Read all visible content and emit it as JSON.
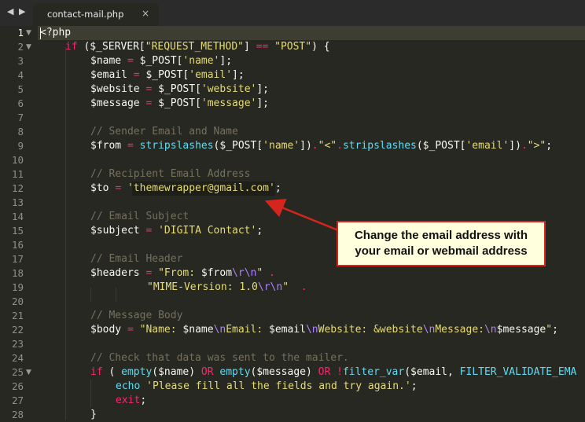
{
  "tab": {
    "label": "contact-mail.php",
    "close": "×"
  },
  "nav": {
    "back": "◀",
    "forward": "▶"
  },
  "fold_glyph": "▼",
  "gutter": [
    "1",
    "2",
    "3",
    "4",
    "5",
    "6",
    "7",
    "8",
    "9",
    "10",
    "11",
    "12",
    "13",
    "14",
    "15",
    "16",
    "17",
    "18",
    "19",
    "20",
    "21",
    "22",
    "23",
    "24",
    "25",
    "26",
    "27",
    "28"
  ],
  "code": {
    "l1": "<?php",
    "l2": {
      "kw": "if",
      "a": " ($_SERVER[",
      "s": "\"REQUEST_METHOD\"",
      "b": "] ",
      "op": "==",
      "c": " ",
      "s2": "\"POST\"",
      "d": ") {"
    },
    "l3": {
      "a": "$name ",
      "op": "=",
      "b": " $_POST[",
      "s": "'name'",
      "c": "];"
    },
    "l4": {
      "a": "$email ",
      "op": "=",
      "b": " $_POST[",
      "s": "'email'",
      "c": "];"
    },
    "l5": {
      "a": "$website ",
      "op": "=",
      "b": " $_POST[",
      "s": "'website'",
      "c": "];"
    },
    "l6": {
      "a": "$message ",
      "op": "=",
      "b": " $_POST[",
      "s": "'message'",
      "c": "];"
    },
    "l8": "// Sender Email and Name",
    "l9": {
      "a": "$from ",
      "op": "=",
      "fn": " stripslashes",
      "b": "($_POST[",
      "s": "'name'",
      "c": "])",
      "dot": ".",
      "s2": "\"<\"",
      "dot2": ".",
      "fn2": "stripslashes",
      "d": "($_POST[",
      "s3": "'email'",
      "e": "])",
      "dot3": ".",
      "s4": "\">\"",
      "f": ";"
    },
    "l11": "// Recipient Email Address",
    "l12": {
      "a": "$to ",
      "op": "=",
      "b": " ",
      "s": "'themewrapper@gmail.com'",
      "c": ";"
    },
    "l14": "// Email Subject",
    "l15": {
      "a": "$subject ",
      "op": "=",
      "b": " ",
      "s": "'DIGITA Contact'",
      "c": ";"
    },
    "l17": "// Email Header",
    "l18": {
      "a": "$headers ",
      "op": "=",
      "b": " ",
      "s": "\"From: ",
      "v": "$from",
      "esc": "\\r\\n",
      "s2": "\"",
      "c": " ",
      "dot": "."
    },
    "l19": {
      "s": "\"MIME-Version: 1.0",
      "esc": "\\r\\n",
      "s2": "\"",
      "c": "  ",
      "dot": "."
    },
    "l21": "// Message Body",
    "l22": {
      "a": "$body ",
      "op": "=",
      "b": " ",
      "s": "\"Name: ",
      "v": "$name",
      "esc": "\\n",
      "s2": "Email: ",
      "v2": "$email",
      "esc2": "\\n",
      "s3": "Website: &website",
      "esc3": "\\n",
      "s4": "Message:",
      "esc4": "\\n",
      "v3": "$message",
      "s5": "\"",
      "c": ";"
    },
    "l24": "// Check that data was sent to the mailer.",
    "l25": {
      "kw": "if",
      "a": " ( ",
      "fn": "empty",
      "b": "($name) ",
      "kw2": "OR",
      "c": " ",
      "fn2": "empty",
      "d": "($message) ",
      "kw3": "OR",
      "e": " ",
      "op": "!",
      "fn3": "filter_var",
      "f": "($email, ",
      "fn4": "FILTER_VALIDATE_EMA"
    },
    "l26": {
      "fn": "echo",
      "a": " ",
      "s": "'Please fill all the fields and try again.'",
      "b": ";"
    },
    "l27": {
      "kw": "exit",
      "a": ";"
    },
    "l28": "}"
  },
  "callout": {
    "line1": "Change the email address with",
    "line2": "your email or webmail address"
  },
  "colors": {
    "background": "#272822",
    "keyword": "#f92672",
    "string": "#e6db74",
    "function": "#66d9ef",
    "comment": "#75715e",
    "callout_border": "#d5251d",
    "callout_bg": "#ffffdd"
  }
}
